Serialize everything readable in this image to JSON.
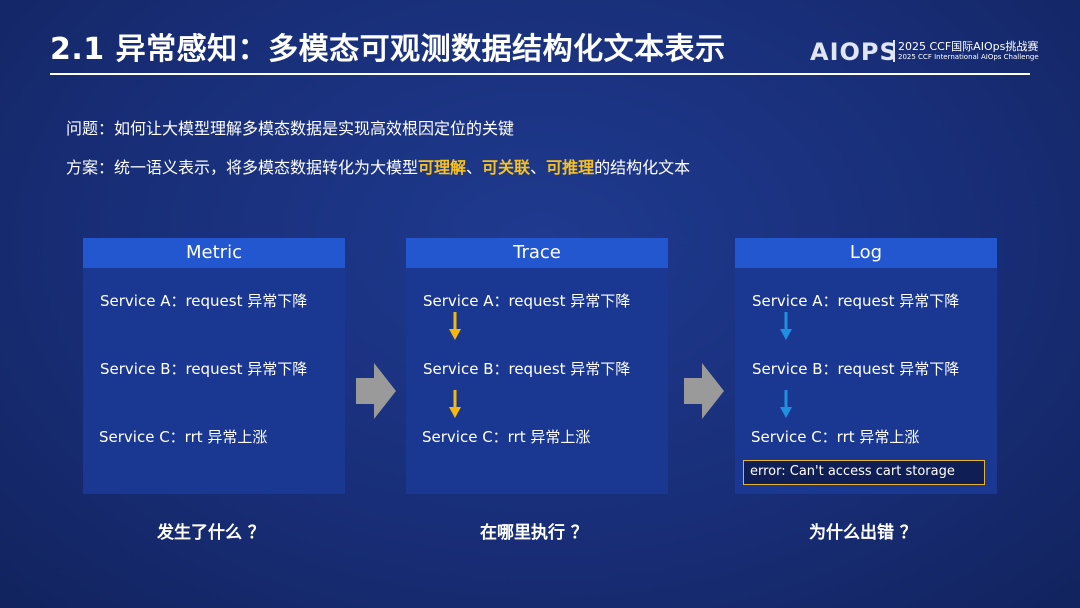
{
  "slide": {
    "title": "2.1 异常感知：多模态可观测数据结构化文本表示"
  },
  "logo": {
    "mark": "AIOPS",
    "line1": "2025 CCF国际AIOps挑战赛",
    "line2": "2025 CCF International AIOps Challenge"
  },
  "problem": {
    "text": "问题：如何让大模型理解多模态数据是实现高效根因定位的关键"
  },
  "solution": {
    "prefix": "方案：统一语义表示，将多模态数据转化为大模型",
    "hl1": "可理解",
    "sep1": "、",
    "hl2": "可关联",
    "sep2": "、",
    "hl3": "可推理",
    "suffix": "的结构化文本"
  },
  "panels": [
    {
      "title": "Metric",
      "rows": [
        "Service A：request 异常下降",
        "Service B：request 异常下降",
        "Service C：rrt 异常上涨"
      ],
      "question": "发生了什么 ？"
    },
    {
      "title": "Trace",
      "rows": [
        "Service A：request 异常下降",
        "Service B：request 异常下降",
        "Service C：rrt 异常上涨"
      ],
      "question": "在哪里执行 ？"
    },
    {
      "title": "Log",
      "rows": [
        "Service A：request 异常下降",
        "Service B：request 异常下降",
        "Service C：rrt 异常上涨"
      ],
      "error": "error: Can't access cart storage",
      "question": "为什么出错 ？"
    }
  ],
  "colors": {
    "background": "#182e78",
    "panel": "#1a3891",
    "panel_header": "#2357cf",
    "highlight": "#f8c21a",
    "trace_arrow": "#f5b80f",
    "log_arrow": "#1f8fe0",
    "flow_arrow": "#9a9a9a"
  }
}
